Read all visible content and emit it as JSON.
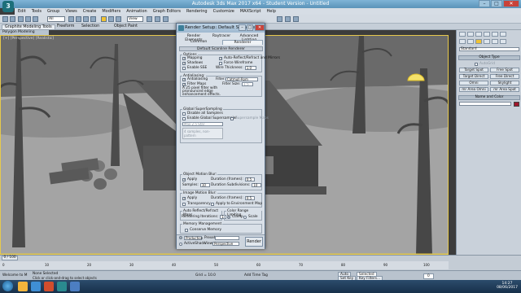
{
  "app": {
    "title": "Autodesk 3ds Max 2017 x64  -  Student Version  -  Untitled",
    "logo": "3"
  },
  "menu": [
    "Edit",
    "Tools",
    "Group",
    "Views",
    "Create",
    "Modifiers",
    "Animation",
    "Graph Editors",
    "Rendering",
    "Customize",
    "MAXScript",
    "Help"
  ],
  "toolbar": {
    "selection_filter": "All",
    "view_select": "View"
  },
  "ribbon": {
    "tabs": [
      "Graphite Modeling Tools",
      "Freeform",
      "Selection",
      "Object Paint"
    ],
    "subtab": "Polygon Modeling"
  },
  "viewport": {
    "label": "[+] [Perspective] [Realistic]"
  },
  "dialog": {
    "title": "Render Setup: Default Scanline R...",
    "tabs_row1": [
      "Render Elements",
      "Raytracer",
      "Advanced Lighting"
    ],
    "tabs_row2": [
      "Common",
      "Renderer"
    ],
    "rollout": "Default Scanline Renderer",
    "options": {
      "label": "Options",
      "mapping": "Mapping",
      "auto_reflect": "Auto-Reflect/Refract and Mirrors",
      "shadows": "Shadows",
      "force_wireframe": "Force Wireframe",
      "enable_sse": "Enable SSE",
      "wire_thickness": "Wire Thickness:",
      "wire_value": "1.0"
    },
    "antialiasing": {
      "label": "Antialiasing:",
      "antialiasing": "Antialiasing",
      "filter_label": "Filter:",
      "filter_value": "Catmull-Rom",
      "filter_maps": "Filter Maps",
      "filter_size_label": "Filter Size:",
      "filter_size": "1.5",
      "desc": "A 25 pixel filter with pronounced edge enhancement effects."
    },
    "supersampling": {
      "label": "Global SuperSampling",
      "disable_all": "Disable all Samplers",
      "enable_global": "Enable Global Supersampler",
      "supersample_maps": "Supersample Maps",
      "sampler": "Max 2.5 Star",
      "sampler_desc": "4 samples, non-pattern"
    },
    "object_blur": {
      "label": "Object Motion Blur:",
      "apply": "Apply",
      "duration_label": "Duration (frames):",
      "duration": "0.5",
      "samples_label": "Samples:",
      "samples": "10",
      "subdivisions_label": "Duration Subdivisions:",
      "subdivisions": "10"
    },
    "image_blur": {
      "label": "Image Motion Blur:",
      "apply": "Apply",
      "duration_label": "Duration (frames):",
      "duration": "0.5",
      "transparency": "Transparency",
      "apply_env": "Apply to Environment Map"
    },
    "reflect": {
      "label": "Auto Reflect/Refract Maps",
      "levels_label": "Rendering Iterations:",
      "levels": "1"
    },
    "color_range": {
      "label": "Color Range Limiting",
      "clamp": "Clamp",
      "scale": "Scale"
    },
    "memory": {
      "label": "Memory Management",
      "conserve": "Conserve Memory"
    },
    "footer": {
      "mode": "Production",
      "preset_label": "Preset:",
      "activeshade": "ActiveShade",
      "view_label": "View:",
      "view_value": "Perspective",
      "render": "Render"
    }
  },
  "cmdpanel": {
    "dropdown": "Standard",
    "object_type": "Object Type",
    "autogrid": "AutoGrid",
    "buttons": [
      "Target Spot",
      "Free Spot",
      "Target Direct",
      "Free Direct",
      "Omni",
      "Skylight",
      "mr Area Omni",
      "mr Area Spot"
    ],
    "name_color": "Name and Color"
  },
  "timeline": {
    "frame": "0 / 100",
    "ticks": [
      "0",
      "10",
      "20",
      "30",
      "40",
      "50",
      "60",
      "70",
      "80",
      "90",
      "100"
    ]
  },
  "status": {
    "welcome": "Welcome to M",
    "none": "None Selected",
    "click_hint": "Click or click-and-drag to select objects",
    "grid": "Grid = 10.0",
    "add_time_tag": "Add Time Tag",
    "auto": "Auto",
    "selected": "Selected",
    "set_key": "Set Key",
    "key_filters": "Key Filters...",
    "frame_value": "0"
  },
  "clock": {
    "time": "14:27",
    "date": "08/06/2017"
  },
  "colors": {
    "accent": "#5a93b8",
    "viewport": "#6f6f6f",
    "dialog": "#d9e0e8",
    "taskbar": "#1d3a58"
  }
}
